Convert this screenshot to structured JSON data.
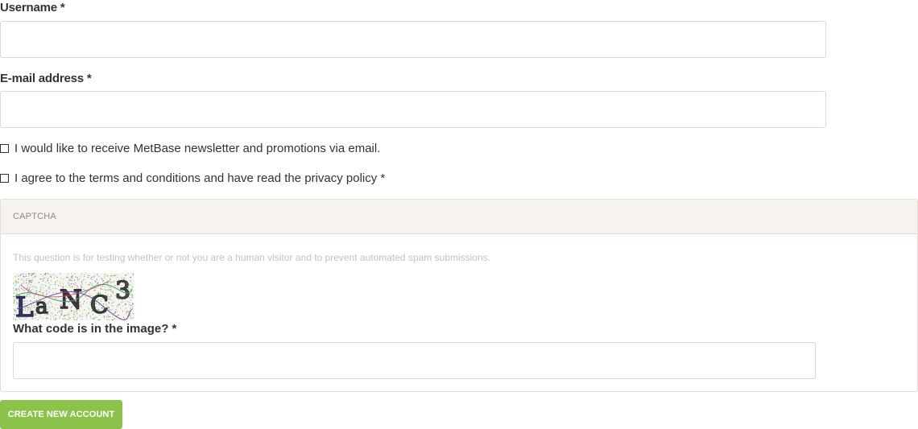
{
  "username": {
    "label": "Username *",
    "value": "",
    "placeholder": ""
  },
  "email": {
    "label": "E-mail address *",
    "value": "",
    "placeholder": ""
  },
  "newsletter": {
    "label": "I would like to receive MetBase newsletter and promotions via email.",
    "checked": false
  },
  "terms": {
    "label": "I agree to the terms and conditions and have read the privacy policy *",
    "checked": false
  },
  "captcha": {
    "title": "CAPTCHA",
    "description": "This question is for testing whether or not you are a human visitor and to prevent automated spam submissions.",
    "image_text": "LaNC3",
    "question_label": "What code is in the image? *",
    "value": ""
  },
  "submit": {
    "label": "CREATE NEW ACCOUNT"
  },
  "colors": {
    "accent": "#8bc34a",
    "captcha_header_bg": "#f6f3ef",
    "border": "#d8d8d8"
  }
}
